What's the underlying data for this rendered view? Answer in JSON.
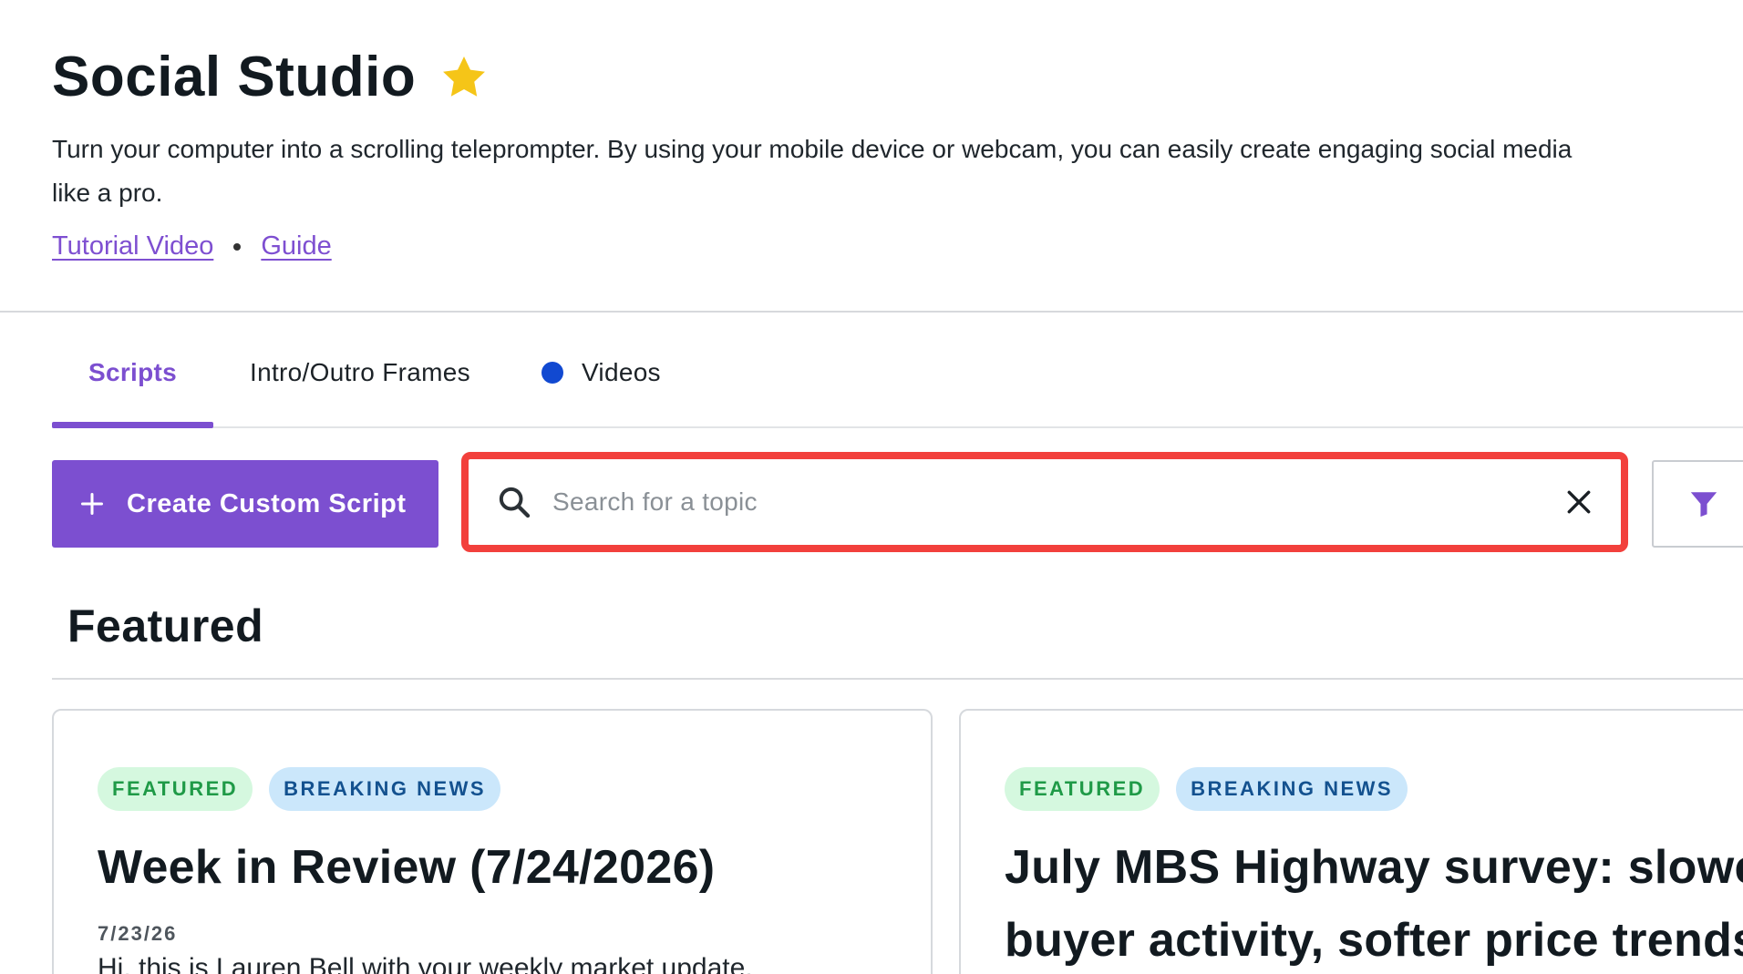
{
  "header": {
    "title": "Social Studio",
    "description_line1": "Turn your computer into a scrolling teleprompter. By using your mobile device or webcam, you can easily create engaging social media",
    "description_line2": "like a pro.",
    "links": {
      "tutorial": "Tutorial Video",
      "guide": "Guide"
    }
  },
  "tabs": [
    {
      "label": "Scripts",
      "active": true
    },
    {
      "label": "Intro/Outro Frames",
      "active": false
    },
    {
      "label": "Videos",
      "active": false
    }
  ],
  "toolbar": {
    "create_label": "Create Custom Script",
    "search_placeholder": "Search for a topic",
    "search_value": ""
  },
  "featured": {
    "title": "Featured",
    "cards": [
      {
        "badges": [
          "FEATURED",
          "BREAKING NEWS"
        ],
        "title": "Week in Review (7/24/2026)",
        "date": "7/23/26",
        "excerpt": "Hi, this is Lauren Bell with your weekly market update."
      },
      {
        "badges": [
          "FEATURED",
          "BREAKING NEWS"
        ],
        "title_line1": "July MBS Highway survey: slower",
        "title_line2": "buyer activity, softer price trends"
      }
    ]
  },
  "colors": {
    "accent": "#7c4fd0",
    "highlight": "#f2403c",
    "status_dot": "#1149d1",
    "star": "#f5c518",
    "badge_featured_bg": "#d5f8df",
    "badge_news_bg": "#cbe7fb"
  },
  "icons": [
    "star-icon",
    "plus-icon",
    "search-icon",
    "close-icon",
    "filter-icon"
  ]
}
